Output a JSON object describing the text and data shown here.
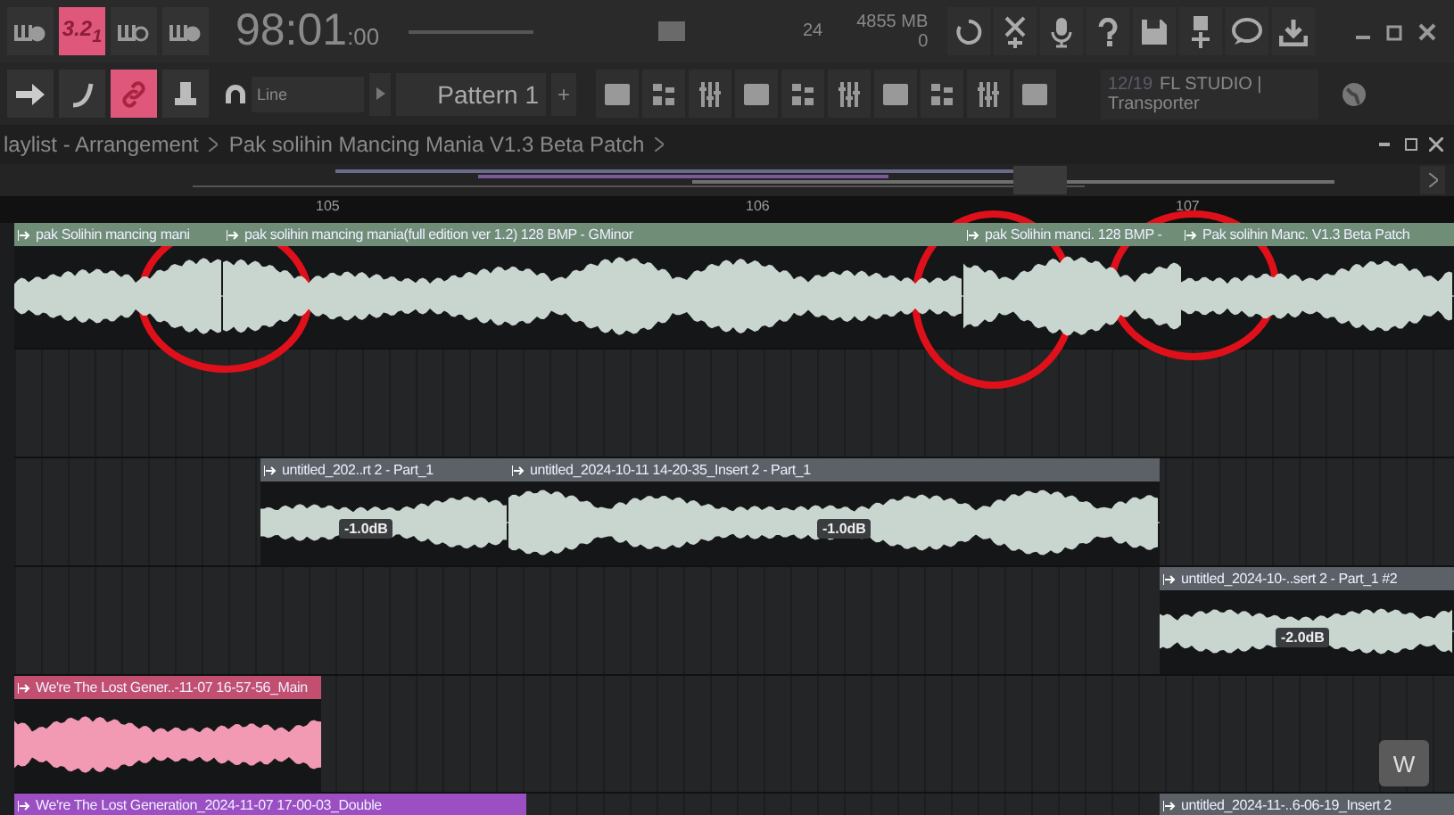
{
  "toolbar": {
    "mode_buttons": [
      {
        "selected": false
      },
      {
        "label": "3.2$_{1}$",
        "selected": true
      },
      {
        "selected": false
      },
      {
        "selected": false
      }
    ],
    "time": "98:01",
    "time_sub": ":00",
    "tempo": "24",
    "memory": "4855 MB",
    "cpu": "0",
    "tool_buttons": [
      {
        "selected": false
      },
      {
        "selected": false
      },
      {
        "selected": true
      },
      {
        "selected": false
      }
    ],
    "snap": "Line",
    "pattern": "Pattern 1",
    "pattern_add": "+",
    "hint_count": "12/19",
    "hint_title": "FL STUDIO |",
    "hint_text": "Transporter"
  },
  "playlist": {
    "breadcrumb": [
      "laylist - Arrangement",
      "Pak solihin Mancing Mania V1.3 Beta Patch"
    ],
    "ruler": [
      "105",
      "106",
      "107"
    ],
    "tracks": [
      {
        "clips": [
          {
            "label": "pak Solihin mancing mani",
            "color": "#6f8d77"
          },
          {
            "label": "pak solihin mancing mania(full edition ver 1.2) 128 BMP - GMinor",
            "color": "#6f8d77"
          },
          {
            "label": "pak Solihin manci. 128 BMP -",
            "color": "#6f8d77"
          },
          {
            "label": "Pak solihin Manc. V1.3 Beta Patch",
            "color": "#6f8d77"
          }
        ]
      },
      {
        "clips": [
          {
            "label": "untitled_202..rt 2 - Part_1",
            "color": "#5b6167",
            "gain": "-1.0dB"
          },
          {
            "label": "untitled_2024-10-11 14-20-35_Insert 2 - Part_1",
            "color": "#5b6167",
            "gain": "-1.0dB"
          }
        ]
      },
      {
        "clips": [
          {
            "label": "untitled_2024-10-..sert 2 - Part_1 #2",
            "color": "#5b6167",
            "gain": "-2.0dB"
          }
        ]
      },
      {
        "clips": [
          {
            "label": "We're The Lost Gener..-11-07 16-57-56_Main",
            "color": "#c24f70"
          }
        ]
      },
      {
        "clips": [
          {
            "label": "We're The Lost Generation_2024-11-07 17-00-03_Double",
            "color": "#9b4fc2"
          },
          {
            "label": "untitled_2024-11-..6-06-19_Insert 2",
            "color": "#5b6167"
          }
        ]
      }
    ],
    "w_button": "W"
  }
}
